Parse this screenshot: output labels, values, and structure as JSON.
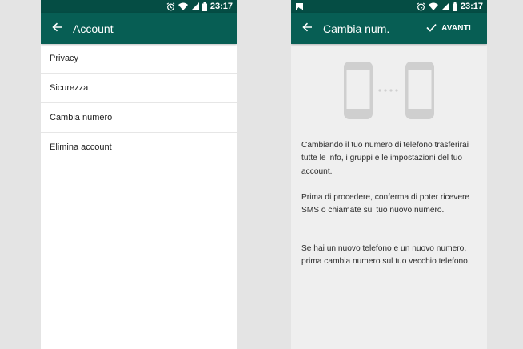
{
  "status_bar": {
    "time": "23:17"
  },
  "left_screen": {
    "title": "Account",
    "items": [
      {
        "label": "Privacy"
      },
      {
        "label": "Sicurezza"
      },
      {
        "label": "Cambia numero"
      },
      {
        "label": "Elimina account"
      }
    ]
  },
  "right_screen": {
    "title": "Cambia num.",
    "next_label": "AVANTI",
    "paragraphs": [
      "Cambiando il tuo numero di telefono trasferirai tutte le info, i gruppi e le impostazioni del tuo account.",
      "Prima di procedere, conferma di poter ricevere SMS o chiamate sul tuo nuovo numero.",
      "Se hai un nuovo telefono e un nuovo numero, prima cambia numero sul tuo vecchio telefono."
    ]
  },
  "colors": {
    "header": "#075e54",
    "status": "#054d44",
    "illustration": "#cfcfcf"
  }
}
